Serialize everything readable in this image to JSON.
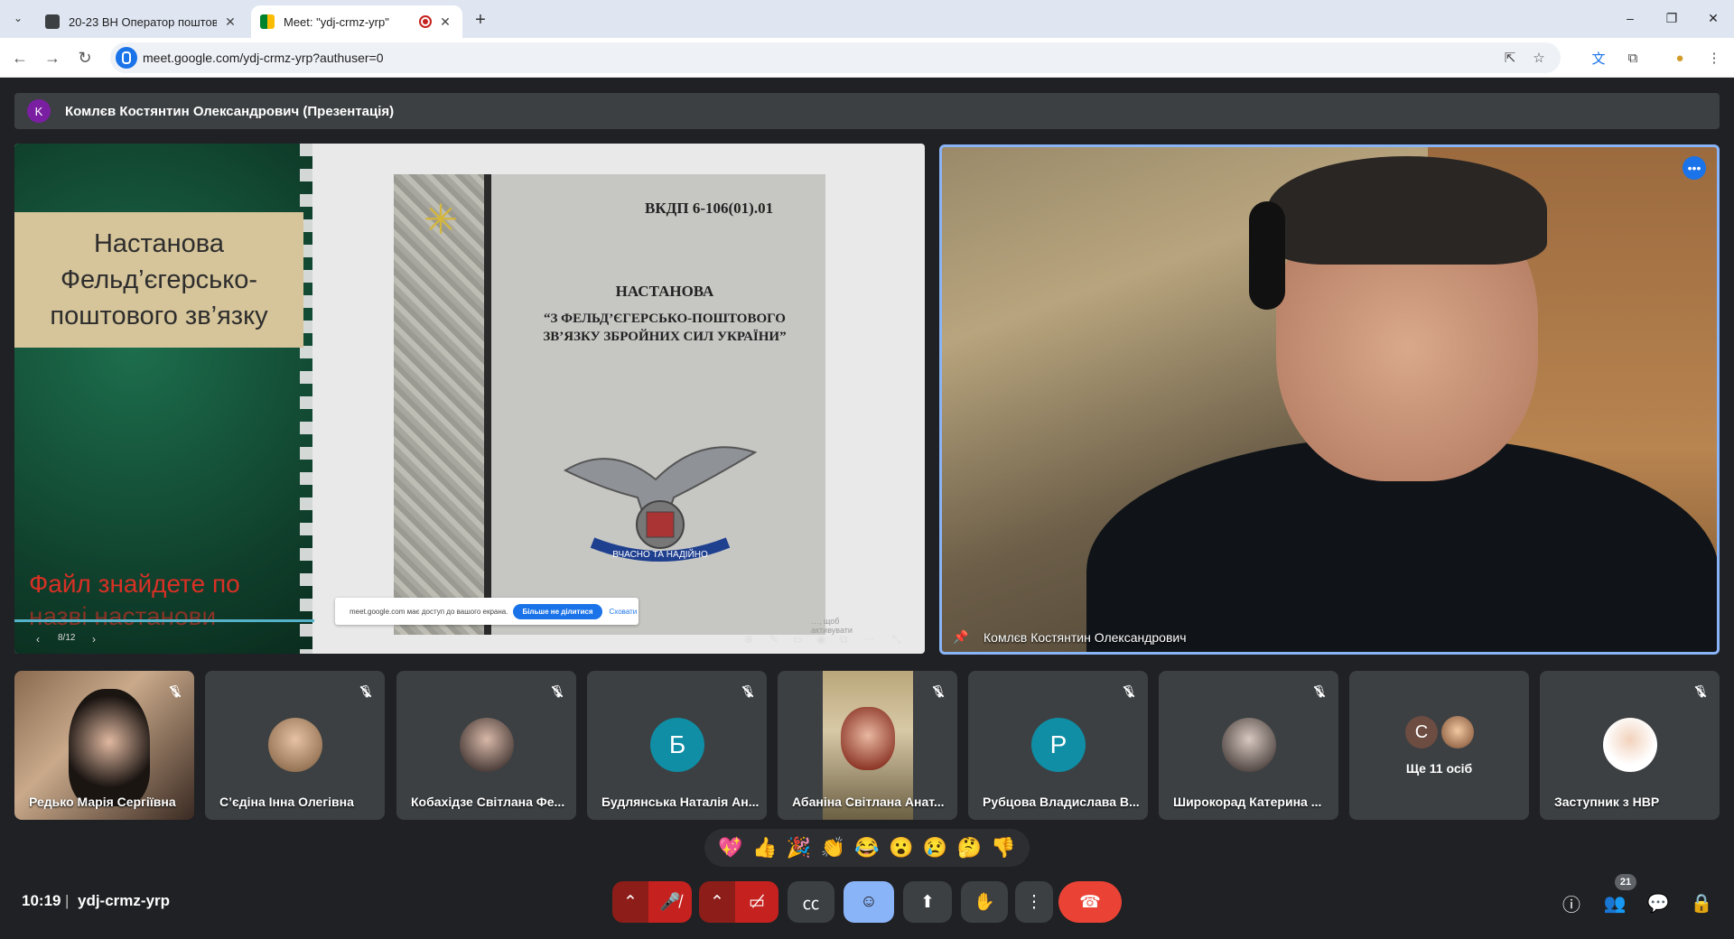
{
  "browser": {
    "tabs": [
      {
        "title": "20-23 ВН Оператор поштово",
        "active": false
      },
      {
        "title": "Meet: \"ydj-crmz-yrp\"",
        "active": true
      }
    ],
    "url": "meet.google.com/ydj-crmz-yrp?authuser=0",
    "window_controls": {
      "minimize": "–",
      "restore": "❐",
      "close": "✕"
    }
  },
  "meet": {
    "presenter_initial": "K",
    "presenter_banner": "Комлєв Костянтин Олександрович (Презентація)",
    "presentation": {
      "slide_title": "Настанова Фельд’єгерсько-поштового зв’язку",
      "slide_red_text": "Файл знайдете по",
      "slide_red_text_2": "назві настанови",
      "doc_code": "ВКДП 6-106(01).01",
      "doc_title_1": "НАСТАНОВА",
      "doc_title_2": "“З ФЕЛЬД’ЄГЕРСЬКО-ПОШТОВОГО ЗВ’ЯЗКУ ЗБРОЙНИХ СИЛ УКРАЇНИ”",
      "emblem_motto": "ВЧАСНО ТА НАДІЙНО",
      "activate_hint": "…, щоб активувати",
      "slide_counter": "8/12",
      "share_notice": "meet.google.com має доступ до вашого екрана.",
      "share_stop": "Більше не ділитися",
      "share_hide": "Сховати"
    },
    "speaker": {
      "name": "Комлєв Костянтин Олександрович"
    },
    "participants": [
      {
        "name": "Редько Марія Сергіївна",
        "type": "video"
      },
      {
        "name": "С’єдіна Інна Олегівна",
        "type": "photo"
      },
      {
        "name": "Кобахідзе Світлана Фе...",
        "type": "photo"
      },
      {
        "name": "Будлянська Наталія Ан...",
        "initial": "Б",
        "color": "#0f8ea5"
      },
      {
        "name": "Абаніна Світлана Анат...",
        "type": "video"
      },
      {
        "name": "Рубцова Владислава В...",
        "initial": "Р",
        "color": "#0f8ea5"
      },
      {
        "name": "Широкорад Катерина ...",
        "type": "photo"
      },
      {
        "more_label": "Ще 11 осіб",
        "initial": "С"
      },
      {
        "name": "Заступник з НВР",
        "type": "photo"
      }
    ],
    "reactions": [
      "💖",
      "👍",
      "🎉",
      "👏",
      "😂",
      "😮",
      "😢",
      "🤔",
      "👎"
    ],
    "bottom": {
      "time": "10:19",
      "separator": "|",
      "meeting_code": "ydj-crmz-yrp",
      "people_count": "21"
    }
  }
}
